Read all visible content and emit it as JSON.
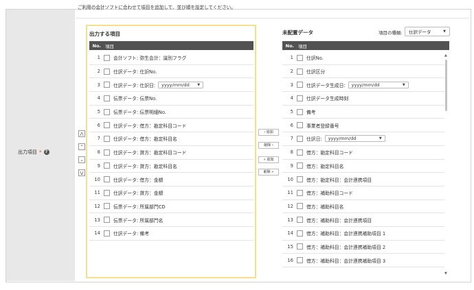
{
  "description": "ご利用の会計ソフトに合わせて項目を追加して、並び順を設定してください。",
  "field": {
    "label": "出力項目",
    "required_mark": "*",
    "help_icon": "?"
  },
  "output": {
    "title": "出力する項目",
    "col_no": "No.",
    "col_item": "項目",
    "rows": [
      {
        "no": "1",
        "text": "会計ソフト: 弥生会計：識別フラグ"
      },
      {
        "no": "2",
        "text": "仕訳データ: 仕訳No."
      },
      {
        "no": "3",
        "text": "仕訳データ: 仕訳日:",
        "select": "yyyy/mm/dd"
      },
      {
        "no": "4",
        "text": "伝票データ: 伝票No."
      },
      {
        "no": "5",
        "text": "伝票データ: 伝票明細No."
      },
      {
        "no": "6",
        "text": "仕訳データ: 借方：勘定科目コード"
      },
      {
        "no": "7",
        "text": "仕訳データ: 借方：勘定科目名"
      },
      {
        "no": "8",
        "text": "仕訳データ: 貸方：勘定科目コード"
      },
      {
        "no": "9",
        "text": "仕訳データ: 貸方：勘定科目名"
      },
      {
        "no": "10",
        "text": "仕訳データ: 借方：金額"
      },
      {
        "no": "11",
        "text": "仕訳データ: 貸方：金額"
      },
      {
        "no": "12",
        "text": "伝票データ: 所属部門CD"
      },
      {
        "no": "13",
        "text": "伝票データ: 所属部門名"
      },
      {
        "no": "14",
        "text": "仕訳データ: 備考"
      }
    ]
  },
  "move": {
    "top": "⋀",
    "up": "⌃",
    "down": "⌄",
    "bottom": "⋁"
  },
  "transfer": {
    "add": "‹ 追加",
    "remove": "削除 ›",
    "add_all": "« 追加",
    "remove_all": "削除 »"
  },
  "unplaced": {
    "title": "未配置データ",
    "type_label": "項目の種類:",
    "type_value": "仕訳データ",
    "col_no": "No.",
    "col_item": "項目",
    "rows": [
      {
        "no": "1",
        "text": "仕訳No."
      },
      {
        "no": "2",
        "text": "仕訳区分"
      },
      {
        "no": "3",
        "text": "仕訳データ生成日:",
        "select": "yyyy/mm/dd"
      },
      {
        "no": "4",
        "text": "仕訳データ生成時刻"
      },
      {
        "no": "5",
        "text": "備考"
      },
      {
        "no": "6",
        "text": "事業者登録番号"
      },
      {
        "no": "7",
        "text": "仕訳日:",
        "select": "yyyy/mm/dd"
      },
      {
        "no": "8",
        "text": "借方：勘定科目コード"
      },
      {
        "no": "9",
        "text": "借方：勘定科目名"
      },
      {
        "no": "10",
        "text": "借方：勘定科目：会計連携項目"
      },
      {
        "no": "11",
        "text": "借方：補助科目コード"
      },
      {
        "no": "12",
        "text": "借方：補助科目名"
      },
      {
        "no": "13",
        "text": "借方：補助科目：会計連携項目"
      },
      {
        "no": "14",
        "text": "借方：補助科目：会計連携補助項目 1"
      },
      {
        "no": "15",
        "text": "借方：補助科目：会計連携補助項目 2"
      },
      {
        "no": "16",
        "text": "借方：補助科目：会計連携補助項目 3"
      }
    ]
  },
  "colors": {
    "header_bg": "#525252",
    "highlight_border": "#f6df8c",
    "label_bg": "#e8e8e8",
    "required": "#e0402a"
  }
}
